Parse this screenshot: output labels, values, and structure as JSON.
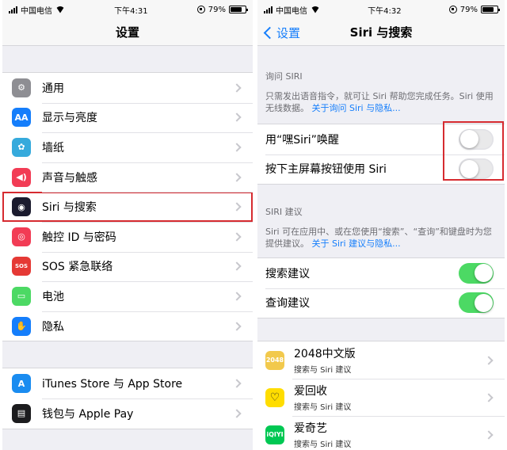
{
  "left": {
    "status": {
      "carrier": "中国电信",
      "time": "下午4:31",
      "battery": "79%",
      "battery_fraction": 0.79
    },
    "title": "设置",
    "group1": [
      {
        "label": "通用",
        "icon": "gear-icon",
        "color": "#8e8e93",
        "glyph": "⚙"
      },
      {
        "label": "显示与亮度",
        "icon": "text-size-icon",
        "color": "#157efb",
        "glyph": "AA"
      },
      {
        "label": "墙纸",
        "icon": "flower-icon",
        "color": "#36aadc",
        "glyph": "✿"
      },
      {
        "label": "声音与触感",
        "icon": "speaker-icon",
        "color": "#f23c55",
        "glyph": "◀)"
      },
      {
        "label": "Siri 与搜索",
        "icon": "siri-icon",
        "color": "#1b1b2e",
        "glyph": "◉",
        "selected": true
      },
      {
        "label": "触控 ID 与密码",
        "icon": "fingerprint-icon",
        "color": "#f23c55",
        "glyph": "◎"
      },
      {
        "label": "SOS 紧急联络",
        "icon": "sos-icon",
        "color": "#e53935",
        "glyph": "SOS"
      },
      {
        "label": "电池",
        "icon": "battery-icon",
        "color": "#4cd964",
        "glyph": "▭"
      },
      {
        "label": "隐私",
        "icon": "hand-icon",
        "color": "#157efb",
        "glyph": "✋"
      }
    ],
    "group2": [
      {
        "label": "iTunes Store 与 App Store",
        "icon": "app-store-icon",
        "color": "#1a8cf0",
        "glyph": "A"
      },
      {
        "label": "钱包与 Apple Pay",
        "icon": "wallet-icon",
        "color": "#1c1c1e",
        "glyph": "▤"
      }
    ]
  },
  "right": {
    "status": {
      "carrier": "中国电信",
      "time": "下午4:32",
      "battery": "79%",
      "battery_fraction": 0.79
    },
    "back_label": "设置",
    "title": "Siri 与搜索",
    "ask_siri": {
      "header": "询问 SIRI",
      "desc": "只需发出语音指令，就可让 Siri 帮助您完成任务。Siri 使用无线数据。",
      "link": "关于询问 Siri 与隐私...",
      "rows": [
        {
          "label": "用“嘿Siri”唤醒",
          "on": false
        },
        {
          "label": "按下主屏幕按钮使用 Siri",
          "on": false
        }
      ]
    },
    "siri_suggestions": {
      "header": "SIRI 建议",
      "desc": "Siri 可在应用中、或在您使用“搜索”、“查询”和键盘时为您提供建议。",
      "link": "关于 Siri 建议与隐私...",
      "rows": [
        {
          "label": "搜索建议",
          "on": true
        },
        {
          "label": "查询建议",
          "on": true
        }
      ]
    },
    "apps": [
      {
        "title": "2048中文版",
        "subtitle": "搜索与 Siri 建议",
        "icon": "app-2048-icon",
        "bg": "#f2c94c",
        "fg": "#ffffff",
        "glyph": "2048"
      },
      {
        "title": "爱回收",
        "subtitle": "搜索与 Siri 建议",
        "icon": "app-aihuishou-icon",
        "bg": "#ffdd00",
        "fg": "#222222",
        "glyph": "♡"
      },
      {
        "title": "爱奇艺",
        "subtitle": "搜索与 Siri 建议",
        "icon": "app-iqiyi-icon",
        "bg": "#00c853",
        "fg": "#ffffff",
        "glyph": "iQIYI"
      }
    ]
  },
  "colors": {
    "ios_blue": "#157efb",
    "toggle_on": "#4cd964",
    "highlight_red": "#d62b30"
  }
}
